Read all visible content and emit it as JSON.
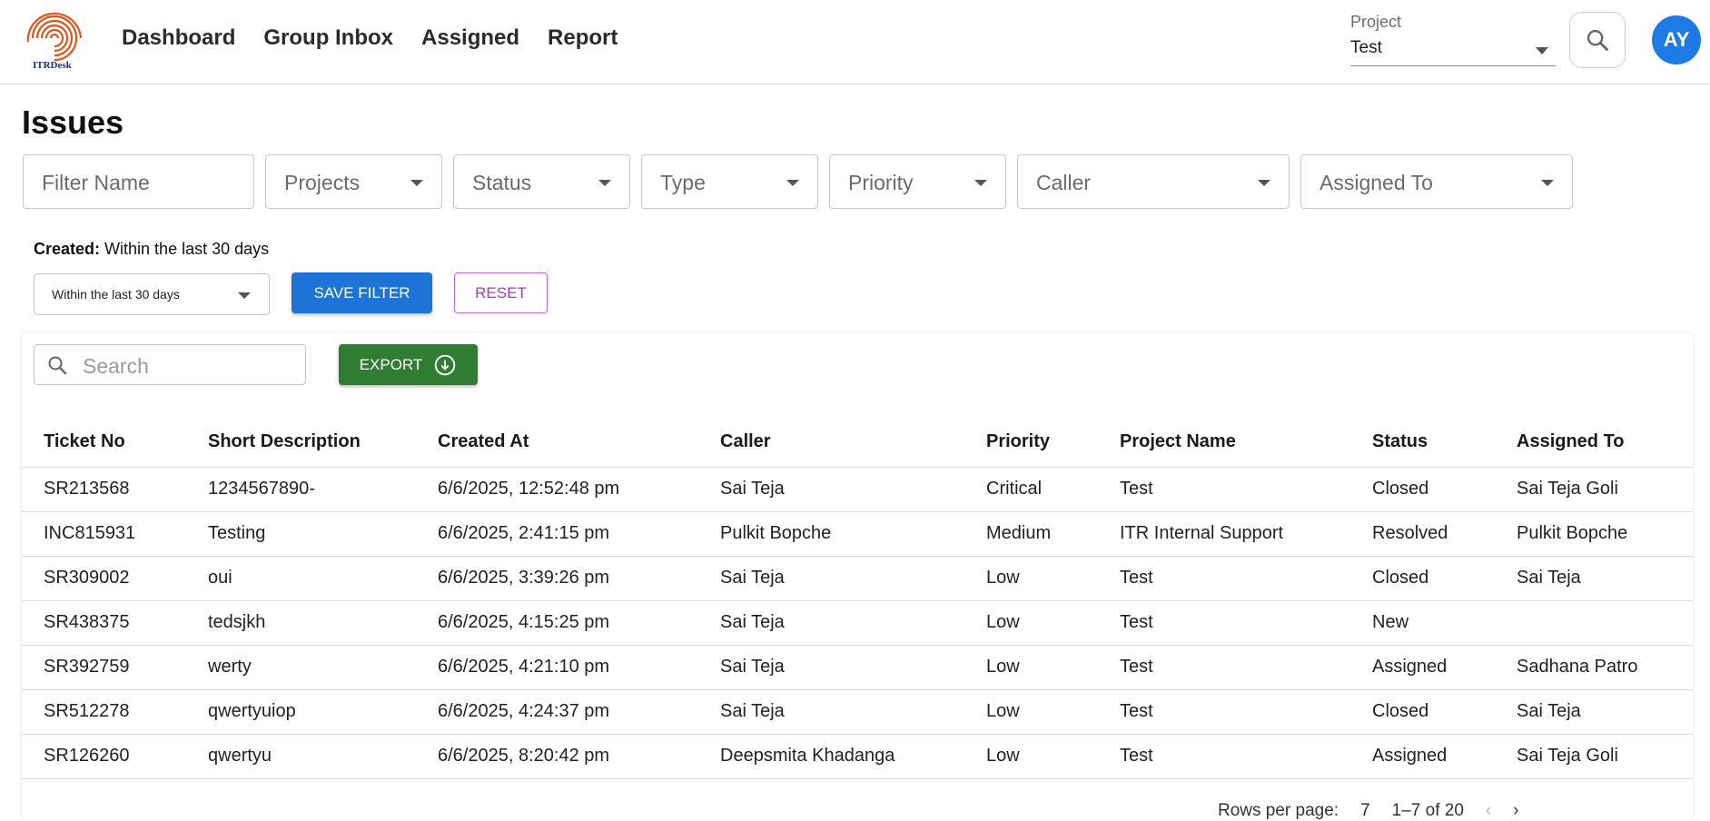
{
  "header": {
    "logo_text": "ITRDesk",
    "nav": [
      "Dashboard",
      "Group Inbox",
      "Assigned",
      "Report"
    ],
    "project_label": "Project",
    "project_value": "Test",
    "avatar_initials": "AY"
  },
  "page": {
    "title": "Issues"
  },
  "filters": {
    "filter_name_placeholder": "Filter Name",
    "projects": "Projects",
    "status": "Status",
    "type": "Type",
    "priority": "Priority",
    "caller": "Caller",
    "assigned_to": "Assigned To"
  },
  "created": {
    "label": "Created:",
    "value": "Within the last 30 days",
    "select_value": "Within the last 30 days"
  },
  "buttons": {
    "save_filter": "SAVE FILTER",
    "reset": "RESET",
    "export": "EXPORT"
  },
  "table_search": {
    "placeholder": "Search"
  },
  "table": {
    "columns": [
      "Ticket No",
      "Short Description",
      "Created At",
      "Caller",
      "Priority",
      "Project Name",
      "Status",
      "Assigned To"
    ],
    "rows": [
      [
        "SR213568",
        "1234567890-",
        "6/6/2025, 12:52:48 pm",
        "Sai Teja",
        "Critical",
        "Test",
        "Closed",
        "Sai Teja Goli"
      ],
      [
        "INC815931",
        "Testing",
        "6/6/2025, 2:41:15 pm",
        "Pulkit Bopche",
        "Medium",
        "ITR Internal Support",
        "Resolved",
        "Pulkit Bopche"
      ],
      [
        "SR309002",
        "oui",
        "6/6/2025, 3:39:26 pm",
        "Sai Teja",
        "Low",
        "Test",
        "Closed",
        "Sai Teja"
      ],
      [
        "SR438375",
        "tedsjkh",
        "6/6/2025, 4:15:25 pm",
        "Sai Teja",
        "Low",
        "Test",
        "New",
        ""
      ],
      [
        "SR392759",
        "werty",
        "6/6/2025, 4:21:10 pm",
        "Sai Teja",
        "Low",
        "Test",
        "Assigned",
        "Sadhana Patro"
      ],
      [
        "SR512278",
        "qwertyuiop",
        "6/6/2025, 4:24:37 pm",
        "Sai Teja",
        "Low",
        "Test",
        "Closed",
        "Sai Teja"
      ],
      [
        "SR126260",
        "qwertyu",
        "6/6/2025, 8:20:42 pm",
        "Deepsmita Khadanga",
        "Low",
        "Test",
        "Assigned",
        "Sai Teja Goli"
      ]
    ]
  },
  "pagination": {
    "rows_per_page_label": "Rows per page:",
    "rows_per_page": "7",
    "range": "1–7 of 20"
  },
  "colors": {
    "primary": "#1e73d6",
    "export": "#2e7d32",
    "reset": "#a23fb3",
    "avatar": "#1e7be6"
  }
}
